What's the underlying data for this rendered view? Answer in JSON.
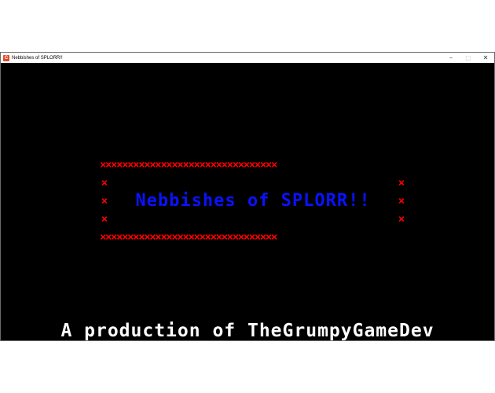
{
  "window": {
    "title": "Nebbishes of SPLORR!!",
    "icon_glyph": "C",
    "icon_color": "#e2492c",
    "minimize_glyph": "–",
    "maximize_glyph": "□",
    "close_glyph": "✕"
  },
  "game": {
    "background": "#000000",
    "title": "Nebbishes of SPLORR!!",
    "title_color": "#0a12ff",
    "frame_char": "×",
    "frame_row": "××××××××××××××××××××××××××××××××",
    "frame_color": "#ff0000",
    "credit": "A production of TheGrumpyGameDev",
    "credit_color": "#ffffff"
  }
}
